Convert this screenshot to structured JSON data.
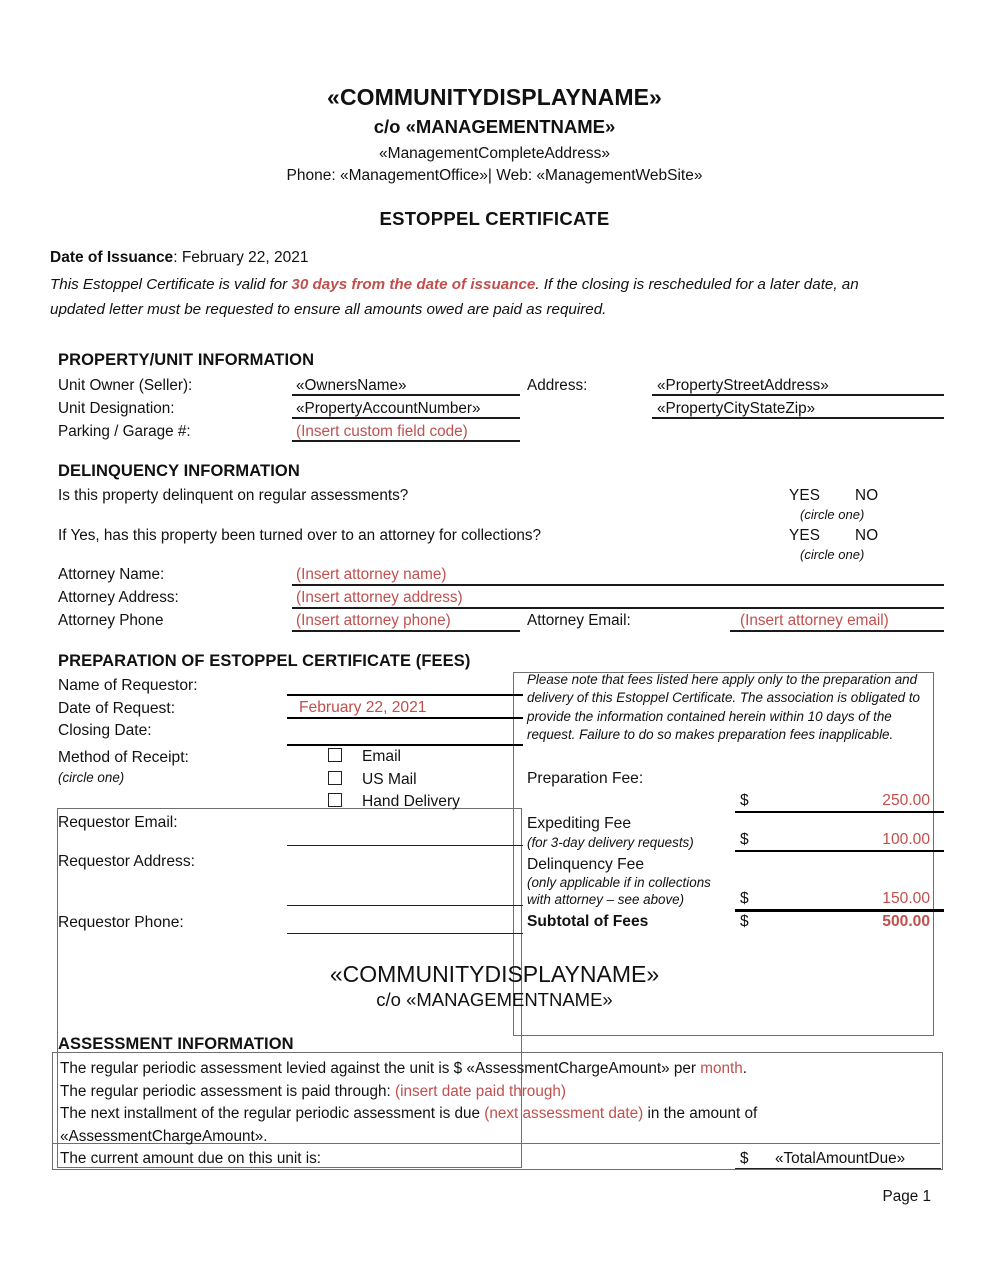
{
  "header": {
    "community": "«COMMUNITYDISPLAYNAME»",
    "care_of": "c/o «MANAGEMENTNAME»",
    "address": "«ManagementCompleteAddress»",
    "contact": "Phone: «ManagementOffice»| Web: «ManagementWebSite»",
    "doc_title": "ESTOPPEL CERTIFICATE"
  },
  "issuance": {
    "label": "Date of Issuance",
    "separator": ": ",
    "date": "February 22, 2021",
    "note_before": "This Estoppel Certificate is valid for ",
    "note_highlight": "30 days from the date of issuance",
    "note_after": ". If the closing is rescheduled for a later date, an updated letter must be requested to ensure all amounts owed are paid as required."
  },
  "property": {
    "section_title": "PROPERTY/UNIT INFORMATION",
    "owner_label": "Unit Owner (Seller):",
    "owner_value": "«OwnersName»",
    "designation_label": "Unit Designation:",
    "designation_value": "«PropertyAccountNumber»",
    "parking_label": "Parking / Garage #:",
    "parking_value": "(Insert custom field code)",
    "address_label": "Address:",
    "street_value": "«PropertyStreetAddress»",
    "citystatezip_value": "«PropertyCityStateZip»"
  },
  "delinquency": {
    "section_title": "DELINQUENCY INFORMATION",
    "question_1": "Is this property delinquent on regular assessments?",
    "question_2": "If Yes, has this property been turned over to an attorney for collections?",
    "yes_label": "YES",
    "no_label": "NO",
    "circle_one": "(circle one)",
    "attorney_name_label": "Attorney Name:",
    "attorney_name_value": "(Insert attorney name)",
    "attorney_address_label": "Attorney Address:",
    "attorney_address_value": "(Insert attorney address)",
    "attorney_phone_label": "Attorney Phone",
    "attorney_phone_value": "(Insert attorney phone)",
    "attorney_email_label": "Attorney Email:",
    "attorney_email_value": "(Insert attorney email)"
  },
  "fees": {
    "section_title": "PREPARATION OF ESTOPPEL CERTIFICATE (FEES)",
    "requestor_name_label": "Name of Requestor:",
    "date_request_label": "Date of Request:",
    "date_request_value": "February 22, 2021",
    "closing_date_label": "Closing Date:",
    "method_label": "Method of Receipt:",
    "method_hint": "(circle one)",
    "methods": [
      "Email",
      "US Mail",
      "Hand Delivery"
    ],
    "requestor_email_label": "Requestor Email:",
    "requestor_address_label": "Requestor Address:",
    "requestor_phone_label": "Requestor Phone:",
    "note": "Please note that fees listed here apply only to the preparation and delivery of this Estoppel Certificate. The association is obligated to provide the information contained herein within 10 days of the request. Failure to do so makes preparation fees inapplicable.",
    "dollar_sign": "$",
    "rows": [
      {
        "label": "Preparation Fee:",
        "sub": "",
        "sub2": "",
        "amount": "250.00"
      },
      {
        "label": "Expediting Fee",
        "sub": "(for 3-day delivery requests)",
        "sub2": "",
        "amount": "100.00"
      },
      {
        "label": "Delinquency Fee",
        "sub": "(only applicable if in collections",
        "sub2": "with attorney – see above)",
        "amount": "150.00"
      }
    ],
    "subtotal_label": "Subtotal of Fees",
    "subtotal_amount": "500.00"
  },
  "overlay_header": {
    "community": "«COMMUNITYDISPLAYNAME»",
    "care_of": "c/o «MANAGEMENTNAME»"
  },
  "assessment": {
    "section_title": "ASSESSMENT INFORMATION",
    "line1_a": "The regular periodic assessment levied against the unit is $ «AssessmentChargeAmount» per ",
    "line1_red": "month",
    "line1_b": ".",
    "line2_a": "The regular periodic assessment is paid through: ",
    "line2_red": "(insert date paid through)",
    "line3_a": "The next installment of the regular periodic assessment is due ",
    "line3_red": "(next assessment date)",
    "line3_b": " in the amount of",
    "line4": "«AssessmentChargeAmount».",
    "line5": "The current amount due on this unit is:",
    "total_dollar": "$",
    "total_value": "«TotalAmountDue»"
  },
  "footer": {
    "page_number": "Page 1"
  },
  "colors": {
    "accent_red": "#C0504D",
    "text": "#111111",
    "box_border": "#6F6F6F"
  }
}
